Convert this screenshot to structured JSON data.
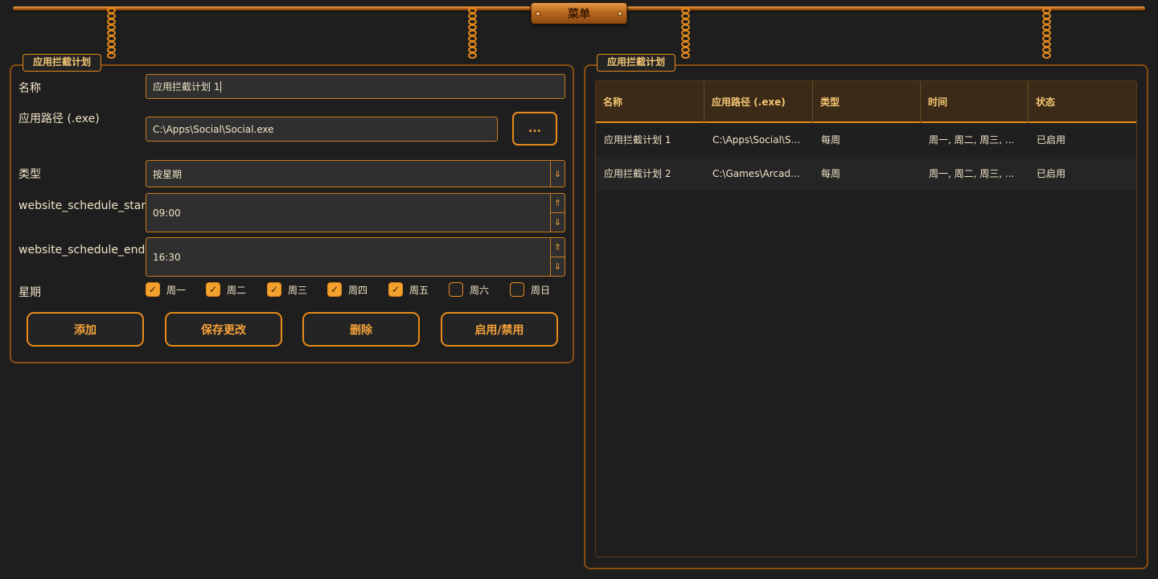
{
  "menu": {
    "label": "菜单"
  },
  "editor": {
    "title": "应用拦截计划",
    "name_label": "名称",
    "name_value": "应用拦截计划 1",
    "path_label": "应用路径 (.exe)",
    "path_value": "C:\\Apps\\Social\\Social.exe",
    "browse_label": "...",
    "type_label": "类型",
    "type_value": "按星期",
    "start_label": "website_schedule_start",
    "start_value": "09:00",
    "end_label": "website_schedule_end",
    "end_value": "16:30",
    "days_label": "星期",
    "days": [
      {
        "label": "周一",
        "checked": true
      },
      {
        "label": "周二",
        "checked": true
      },
      {
        "label": "周三",
        "checked": true
      },
      {
        "label": "周四",
        "checked": true
      },
      {
        "label": "周五",
        "checked": true
      },
      {
        "label": "周六",
        "checked": false
      },
      {
        "label": "周日",
        "checked": false
      }
    ],
    "buttons": {
      "add": "添加",
      "save": "保存更改",
      "delete": "删除",
      "toggle": "启用/禁用"
    }
  },
  "list": {
    "title": "应用拦截计划",
    "columns": [
      "名称",
      "应用路径 (.exe)",
      "类型",
      "时间",
      "状态"
    ],
    "rows": [
      [
        "应用拦截计划 1",
        "C:\\Apps\\Social\\S...",
        "每周",
        "周一, 周二, 周三, ...",
        "已启用"
      ],
      [
        "应用拦截计划 2",
        "C:\\Games\\Arcade...",
        "每周",
        "周一, 周二, 周三, ...",
        "已启用"
      ]
    ]
  },
  "colors": {
    "accent": "#e68a1a",
    "background": "#1e1e1e",
    "text": "#f1e3c8",
    "header": "#3b2a17"
  },
  "icons": {
    "checkbox_checked": "check-icon",
    "combo": "arrow-down-icon",
    "spin_up": "arrow-up-icon",
    "spin_down": "arrow-down-icon"
  }
}
